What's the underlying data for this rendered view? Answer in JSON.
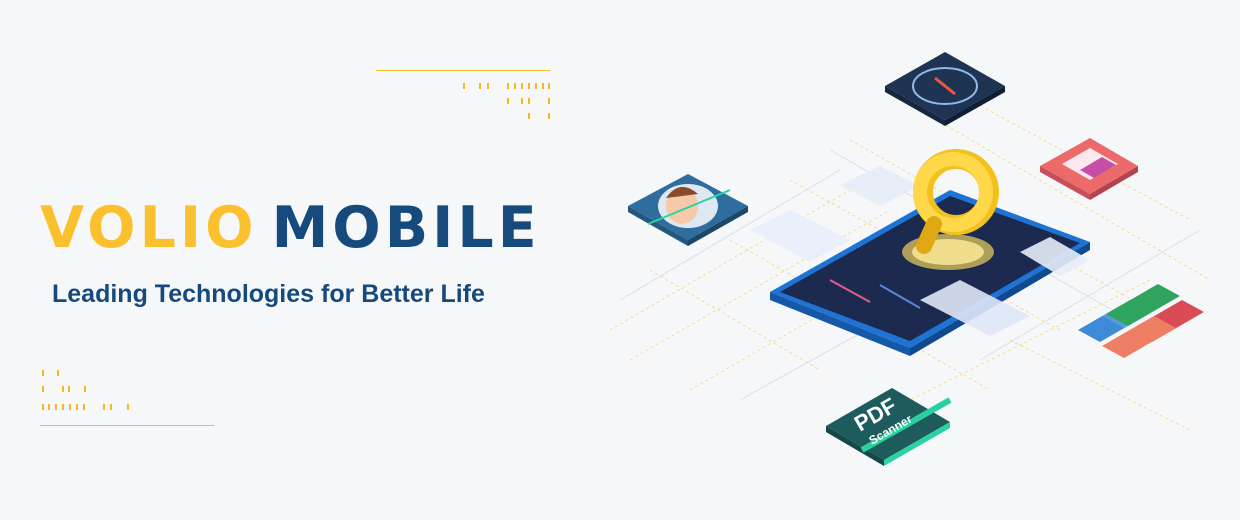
{
  "brand": {
    "word1": "VOLIO",
    "word2": "MOBILE",
    "tagline": "Leading Technologies for Better Life"
  },
  "colors": {
    "yellow": "#fbc02d",
    "navy": "#174a7c",
    "background": "#f6f7f9"
  },
  "apps": {
    "pdf_scanner": {
      "line1": "PDF",
      "line2": "Scanner"
    }
  },
  "icons": [
    "compass-icon",
    "gallery-icon",
    "face-scan-icon",
    "office-docs-icon",
    "pdf-scanner-icon",
    "search-icon",
    "phone-illustration"
  ]
}
